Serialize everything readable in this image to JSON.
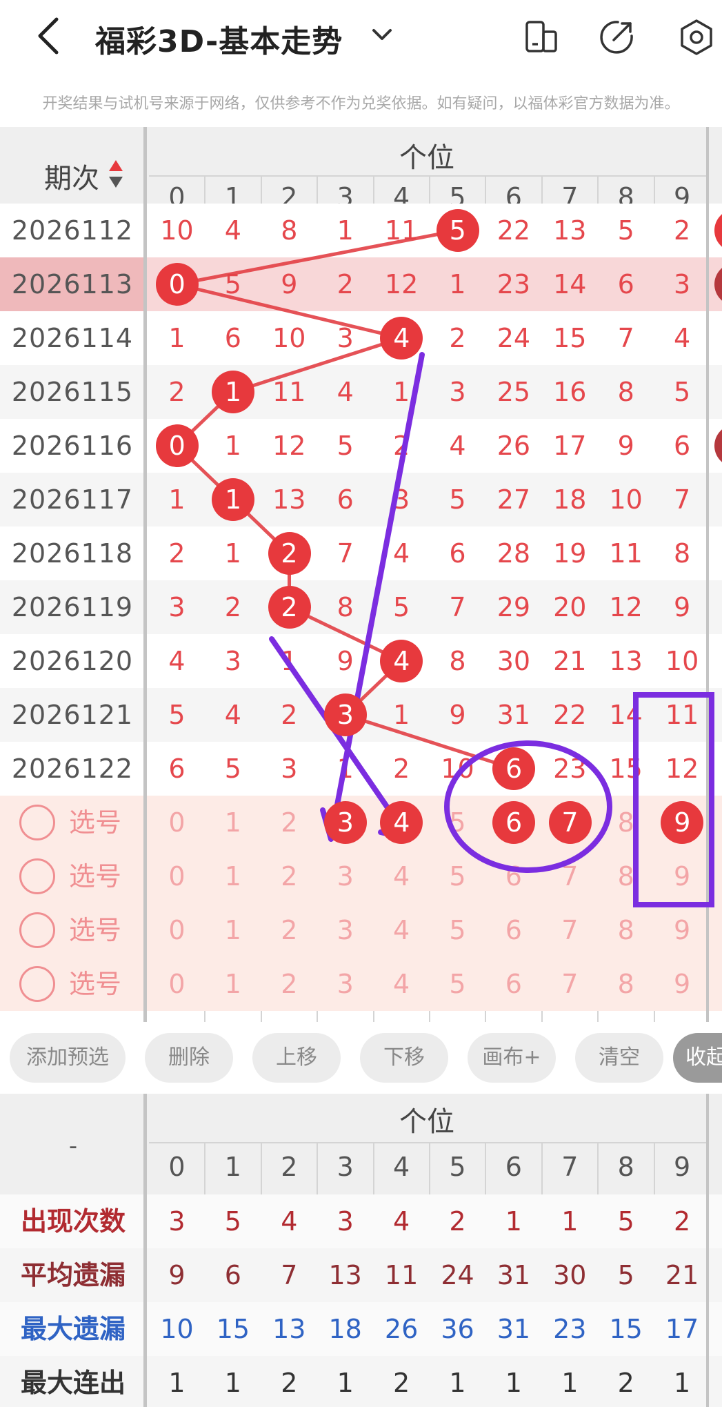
{
  "header": {
    "title": "福彩3D-基本走势",
    "notice": "开奖结果与试机号来源于网络，仅供参考不作为兑奖依据。如有疑问，以福体彩官方数据为准。"
  },
  "grid": {
    "period_label": "期次",
    "group_label": "个位",
    "columns": [
      "0",
      "1",
      "2",
      "3",
      "4",
      "5",
      "6",
      "7",
      "8",
      "9"
    ],
    "rows": [
      {
        "period": "2026112",
        "values": [
          "10",
          "4",
          "8",
          "1",
          "11",
          "5",
          "22",
          "13",
          "5",
          "2"
        ],
        "hit": 5
      },
      {
        "period": "2026113",
        "values": [
          "0",
          "5",
          "9",
          "2",
          "12",
          "1",
          "23",
          "14",
          "6",
          "3"
        ],
        "hit": 0,
        "highlight": true
      },
      {
        "period": "2026114",
        "values": [
          "1",
          "6",
          "10",
          "3",
          "4",
          "2",
          "24",
          "15",
          "7",
          "4"
        ],
        "hit": 4
      },
      {
        "period": "2026115",
        "values": [
          "2",
          "1",
          "11",
          "4",
          "1",
          "3",
          "25",
          "16",
          "8",
          "5"
        ],
        "hit": 1
      },
      {
        "period": "2026116",
        "values": [
          "0",
          "1",
          "12",
          "5",
          "2",
          "4",
          "26",
          "17",
          "9",
          "6"
        ],
        "hit": 0
      },
      {
        "period": "2026117",
        "values": [
          "1",
          "1",
          "13",
          "6",
          "3",
          "5",
          "27",
          "18",
          "10",
          "7"
        ],
        "hit": 1
      },
      {
        "period": "2026118",
        "values": [
          "2",
          "1",
          "2",
          "7",
          "4",
          "6",
          "28",
          "19",
          "11",
          "8"
        ],
        "hit": 2
      },
      {
        "period": "2026119",
        "values": [
          "3",
          "2",
          "2",
          "8",
          "5",
          "7",
          "29",
          "20",
          "12",
          "9"
        ],
        "hit": 2
      },
      {
        "period": "2026120",
        "values": [
          "4",
          "3",
          "1",
          "9",
          "4",
          "8",
          "30",
          "21",
          "13",
          "10"
        ],
        "hit": 4
      },
      {
        "period": "2026121",
        "values": [
          "5",
          "4",
          "2",
          "3",
          "1",
          "9",
          "31",
          "22",
          "14",
          "11"
        ],
        "hit": 3
      },
      {
        "period": "2026122",
        "values": [
          "6",
          "5",
          "3",
          "1",
          "2",
          "10",
          "6",
          "23",
          "15",
          "12"
        ],
        "hit": 6
      }
    ],
    "select_rows": [
      {
        "label": "选号",
        "selected": [
          "3",
          "4",
          "6",
          "7",
          "9"
        ]
      },
      {
        "label": "选号",
        "selected": []
      },
      {
        "label": "选号",
        "selected": []
      },
      {
        "label": "选号",
        "selected": []
      }
    ]
  },
  "toolbar": {
    "buttons": [
      "添加预选",
      "删除",
      "上移",
      "下移",
      "画布+",
      "清空",
      "收起"
    ]
  },
  "stats": {
    "corner_label": "-",
    "group_label": "个位",
    "columns": [
      "0",
      "1",
      "2",
      "3",
      "4",
      "5",
      "6",
      "7",
      "8",
      "9"
    ],
    "rows": [
      {
        "label": "出现次数",
        "color": "#b22a30",
        "values": [
          "3",
          "5",
          "4",
          "3",
          "4",
          "2",
          "1",
          "1",
          "5",
          "2"
        ]
      },
      {
        "label": "平均遗漏",
        "color": "#8e2e33",
        "values": [
          "9",
          "6",
          "7",
          "13",
          "11",
          "24",
          "31",
          "30",
          "5",
          "21"
        ]
      },
      {
        "label": "最大遗漏",
        "color": "#2f63c4",
        "values": [
          "10",
          "15",
          "13",
          "18",
          "26",
          "36",
          "31",
          "23",
          "15",
          "17"
        ]
      },
      {
        "label": "最大连出",
        "color": "#333333",
        "values": [
          "1",
          "1",
          "2",
          "1",
          "2",
          "1",
          "1",
          "1",
          "2",
          "1"
        ]
      }
    ]
  },
  "annotations": {
    "color": "#7b2de0",
    "trend_line_color": "#e34045"
  }
}
